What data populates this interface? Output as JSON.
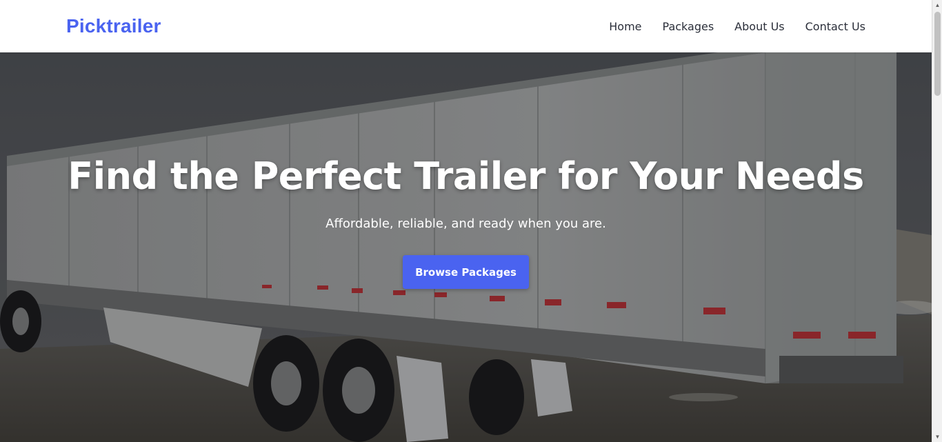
{
  "header": {
    "brand": "Picktrailer",
    "nav": [
      {
        "label": "Home"
      },
      {
        "label": "Packages"
      },
      {
        "label": "About Us"
      },
      {
        "label": "Contact Us"
      }
    ]
  },
  "hero": {
    "title": "Find the Perfect Trailer for Your Needs",
    "subtitle": "Affordable, reliable, and ready when you are.",
    "cta_label": "Browse Packages",
    "background": "photo of a white semi-trailer parked outdoors"
  },
  "colors": {
    "brand": "#4a63f0",
    "nav_text": "#2b2f3a",
    "hero_text": "#ffffff"
  },
  "icons": {
    "scroll_up": "triangle-up-icon",
    "scroll_down": "triangle-down-icon"
  }
}
